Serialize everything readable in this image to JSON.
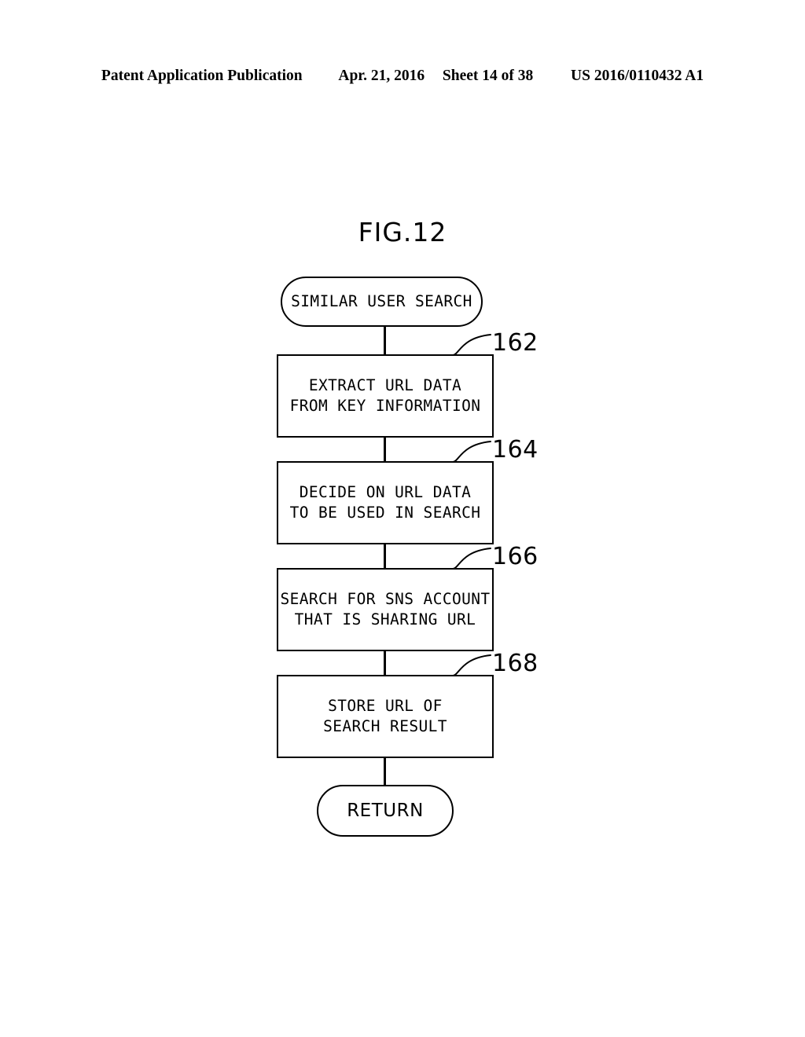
{
  "header": {
    "publication": "Patent Application Publication",
    "date": "Apr. 21, 2016",
    "sheet": "Sheet 14 of 38",
    "pub_number": "US 2016/0110432 A1"
  },
  "figure": {
    "title": "FIG.12",
    "ink_color": "#000000",
    "page_color": "#ffffff"
  },
  "flowchart": {
    "nodes": [
      {
        "id": "start",
        "shape": "terminator",
        "label": "SIMILAR USER SEARCH",
        "ref": ""
      },
      {
        "id": "162",
        "shape": "process",
        "label": "EXTRACT URL DATA\nFROM KEY INFORMATION",
        "ref": "162"
      },
      {
        "id": "164",
        "shape": "process",
        "label": "DECIDE ON URL DATA\nTO BE USED IN SEARCH",
        "ref": "164"
      },
      {
        "id": "166",
        "shape": "process",
        "label": "SEARCH FOR SNS ACCOUNT\nTHAT IS SHARING URL",
        "ref": "166"
      },
      {
        "id": "168",
        "shape": "process",
        "label": "STORE URL OF\nSEARCH RESULT",
        "ref": "168"
      },
      {
        "id": "return",
        "shape": "terminator",
        "label": "RETURN",
        "ref": ""
      }
    ],
    "ref_numerals": [
      "162",
      "164",
      "166",
      "168"
    ]
  }
}
